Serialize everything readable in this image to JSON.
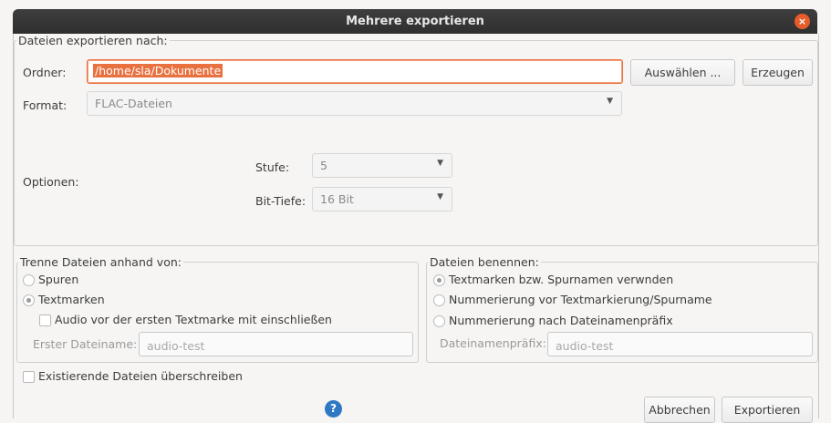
{
  "window": {
    "title": "Mehrere exportieren",
    "close_glyph": "×"
  },
  "export_to": {
    "legend": "Dateien exportieren nach:",
    "folder_label": "Ordner:",
    "folder_value": "/home/sla/Dokumente",
    "choose_button": "Auswählen ...",
    "create_button": "Erzeugen",
    "format_label": "Format:",
    "format_value": "FLAC-Dateien",
    "options_label": "Optionen:",
    "level_label": "Stufe:",
    "level_value": "5",
    "bitdepth_label": "Bit-Tiefe:",
    "bitdepth_value": "16 Bit"
  },
  "split": {
    "legend": "Trenne Dateien anhand von:",
    "tracks_label": "Spuren",
    "markers_label": "Textmarken",
    "include_audio_label": "Audio vor der ersten Textmarke mit einschließen",
    "first_filename_label": "Erster Dateiname:",
    "first_filename_placeholder": "audio-test"
  },
  "naming": {
    "legend": "Dateien benennen:",
    "opt1": "Textmarken bzw. Spurnamen verwnden",
    "opt2": "Nummerierung vor Textmarkierung/Spurname",
    "opt3": "Nummerierung nach Dateinamenpräfix",
    "prefix_label": "Dateinamenpräfix:",
    "prefix_placeholder": "audio-test"
  },
  "overwrite_label": "Existierende Dateien überschreiben",
  "footer": {
    "help_glyph": "?",
    "cancel": "Abbrechen",
    "export": "Exportieren"
  },
  "colors": {
    "accent": "#e9703f",
    "titlebar": "#333333",
    "help": "#2f78c4"
  }
}
